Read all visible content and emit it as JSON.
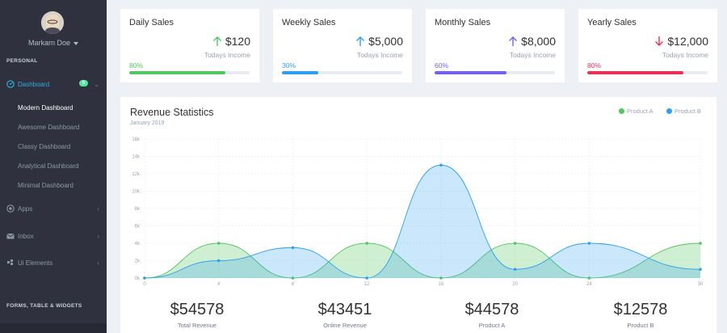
{
  "sidebar": {
    "user_name": "Markarn Doe",
    "section_personal": "PERSONAL",
    "section_forms": "FORMS, TABLE & WIDGETS",
    "items": [
      {
        "label": "Dashboard",
        "icon": "dashboard-icon",
        "badge": "5"
      },
      {
        "label": "Apps",
        "icon": "apps-icon"
      },
      {
        "label": "Inbox",
        "icon": "inbox-icon"
      },
      {
        "label": "Ui Elements",
        "icon": "ui-elements-icon"
      }
    ],
    "sub_items": [
      "Modern Dashboard",
      "Awesome Dashboard",
      "Classy Dashboard",
      "Analytical Dashboard",
      "Minimal Dashboard"
    ]
  },
  "cards": [
    {
      "title": "Daily Sales",
      "amount": "$120",
      "sub": "Todays Income",
      "percent": "80%",
      "progress": 0.8,
      "direction": "up",
      "color": "#53c55d"
    },
    {
      "title": "Weekly Sales",
      "amount": "$5,000",
      "sub": "Todays Income",
      "percent": "30%",
      "progress": 0.3,
      "direction": "up",
      "color": "#2d9ef1"
    },
    {
      "title": "Monthly Sales",
      "amount": "$8,000",
      "sub": "Todays Income",
      "percent": "60%",
      "progress": 0.6,
      "direction": "up",
      "color": "#7460ee"
    },
    {
      "title": "Yearly Sales",
      "amount": "$12,000",
      "sub": "Todays Income",
      "percent": "80%",
      "progress": 0.8,
      "direction": "down",
      "color": "#ee2f55"
    }
  ],
  "revenue": {
    "title": "Revenue Statistics",
    "subtitle": "January 2019",
    "totals": [
      {
        "amount": "$54578",
        "label": "Total Revenue"
      },
      {
        "amount": "$43451",
        "label": "Online Revenue"
      },
      {
        "amount": "$44578",
        "label": "Product A"
      },
      {
        "amount": "$12578",
        "label": "Product B"
      }
    ]
  },
  "chart_data": {
    "type": "area",
    "x": [
      0,
      4,
      8,
      12,
      16,
      20,
      24,
      30
    ],
    "ylim": [
      0,
      16000
    ],
    "y_ticks": [
      "0k",
      "2k",
      "4k",
      "6k",
      "8k",
      "10k",
      "12k",
      "14k",
      "16k"
    ],
    "x_ticks": [
      "0",
      "4",
      "8",
      "12",
      "16",
      "20",
      "24",
      "30"
    ],
    "series": [
      {
        "name": "Product A",
        "color": "#53c55d",
        "values": [
          0,
          4000,
          0,
          4000,
          0,
          4000,
          0,
          4000
        ]
      },
      {
        "name": "Product B",
        "color": "#2d9ef1",
        "values": [
          0,
          2000,
          3500,
          0,
          13000,
          1000,
          4000,
          1000
        ]
      }
    ],
    "grid": true,
    "legend": "top-right"
  }
}
